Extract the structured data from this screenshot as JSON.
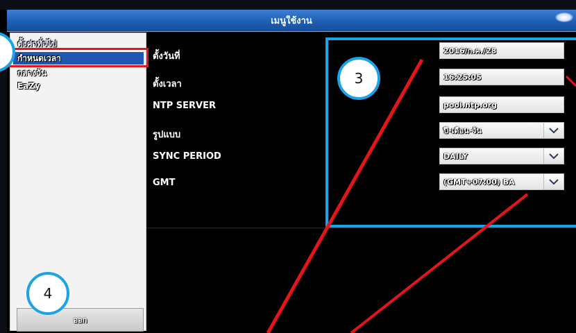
{
  "window": {
    "title": "เมนูใช้งาน"
  },
  "sidebar": {
    "items": [
      {
        "label": "ตั้งค่าทั่วไป"
      },
      {
        "label": "กำหนดเวลา"
      },
      {
        "label": "กลางวัน"
      },
      {
        "label": "EaZy"
      }
    ],
    "exit_label": "ออก"
  },
  "settings": {
    "date": {
      "label": "ตั้งวันที่",
      "value": "2016/ก.ค./28"
    },
    "time": {
      "label": "ตั้งเวลา",
      "value": "16:25:05"
    },
    "ntp": {
      "label": "NTP SERVER",
      "value": "pool.ntp.org"
    },
    "format": {
      "label": "รูปแบบ",
      "value": "ปี-เดือน-วัน"
    },
    "sync": {
      "label": "SYNC PERIOD",
      "value": "DAILY"
    },
    "gmt": {
      "label": "GMT",
      "value": "(GMT+07:00) BA"
    }
  },
  "annotations": {
    "marker_3": "3",
    "marker_4": "4"
  },
  "colors": {
    "titlebar": "#1f5fb4",
    "highlight_box": "#e3151a",
    "callout_box": "#1aa3e6",
    "selected_item": "#1f58b0"
  }
}
